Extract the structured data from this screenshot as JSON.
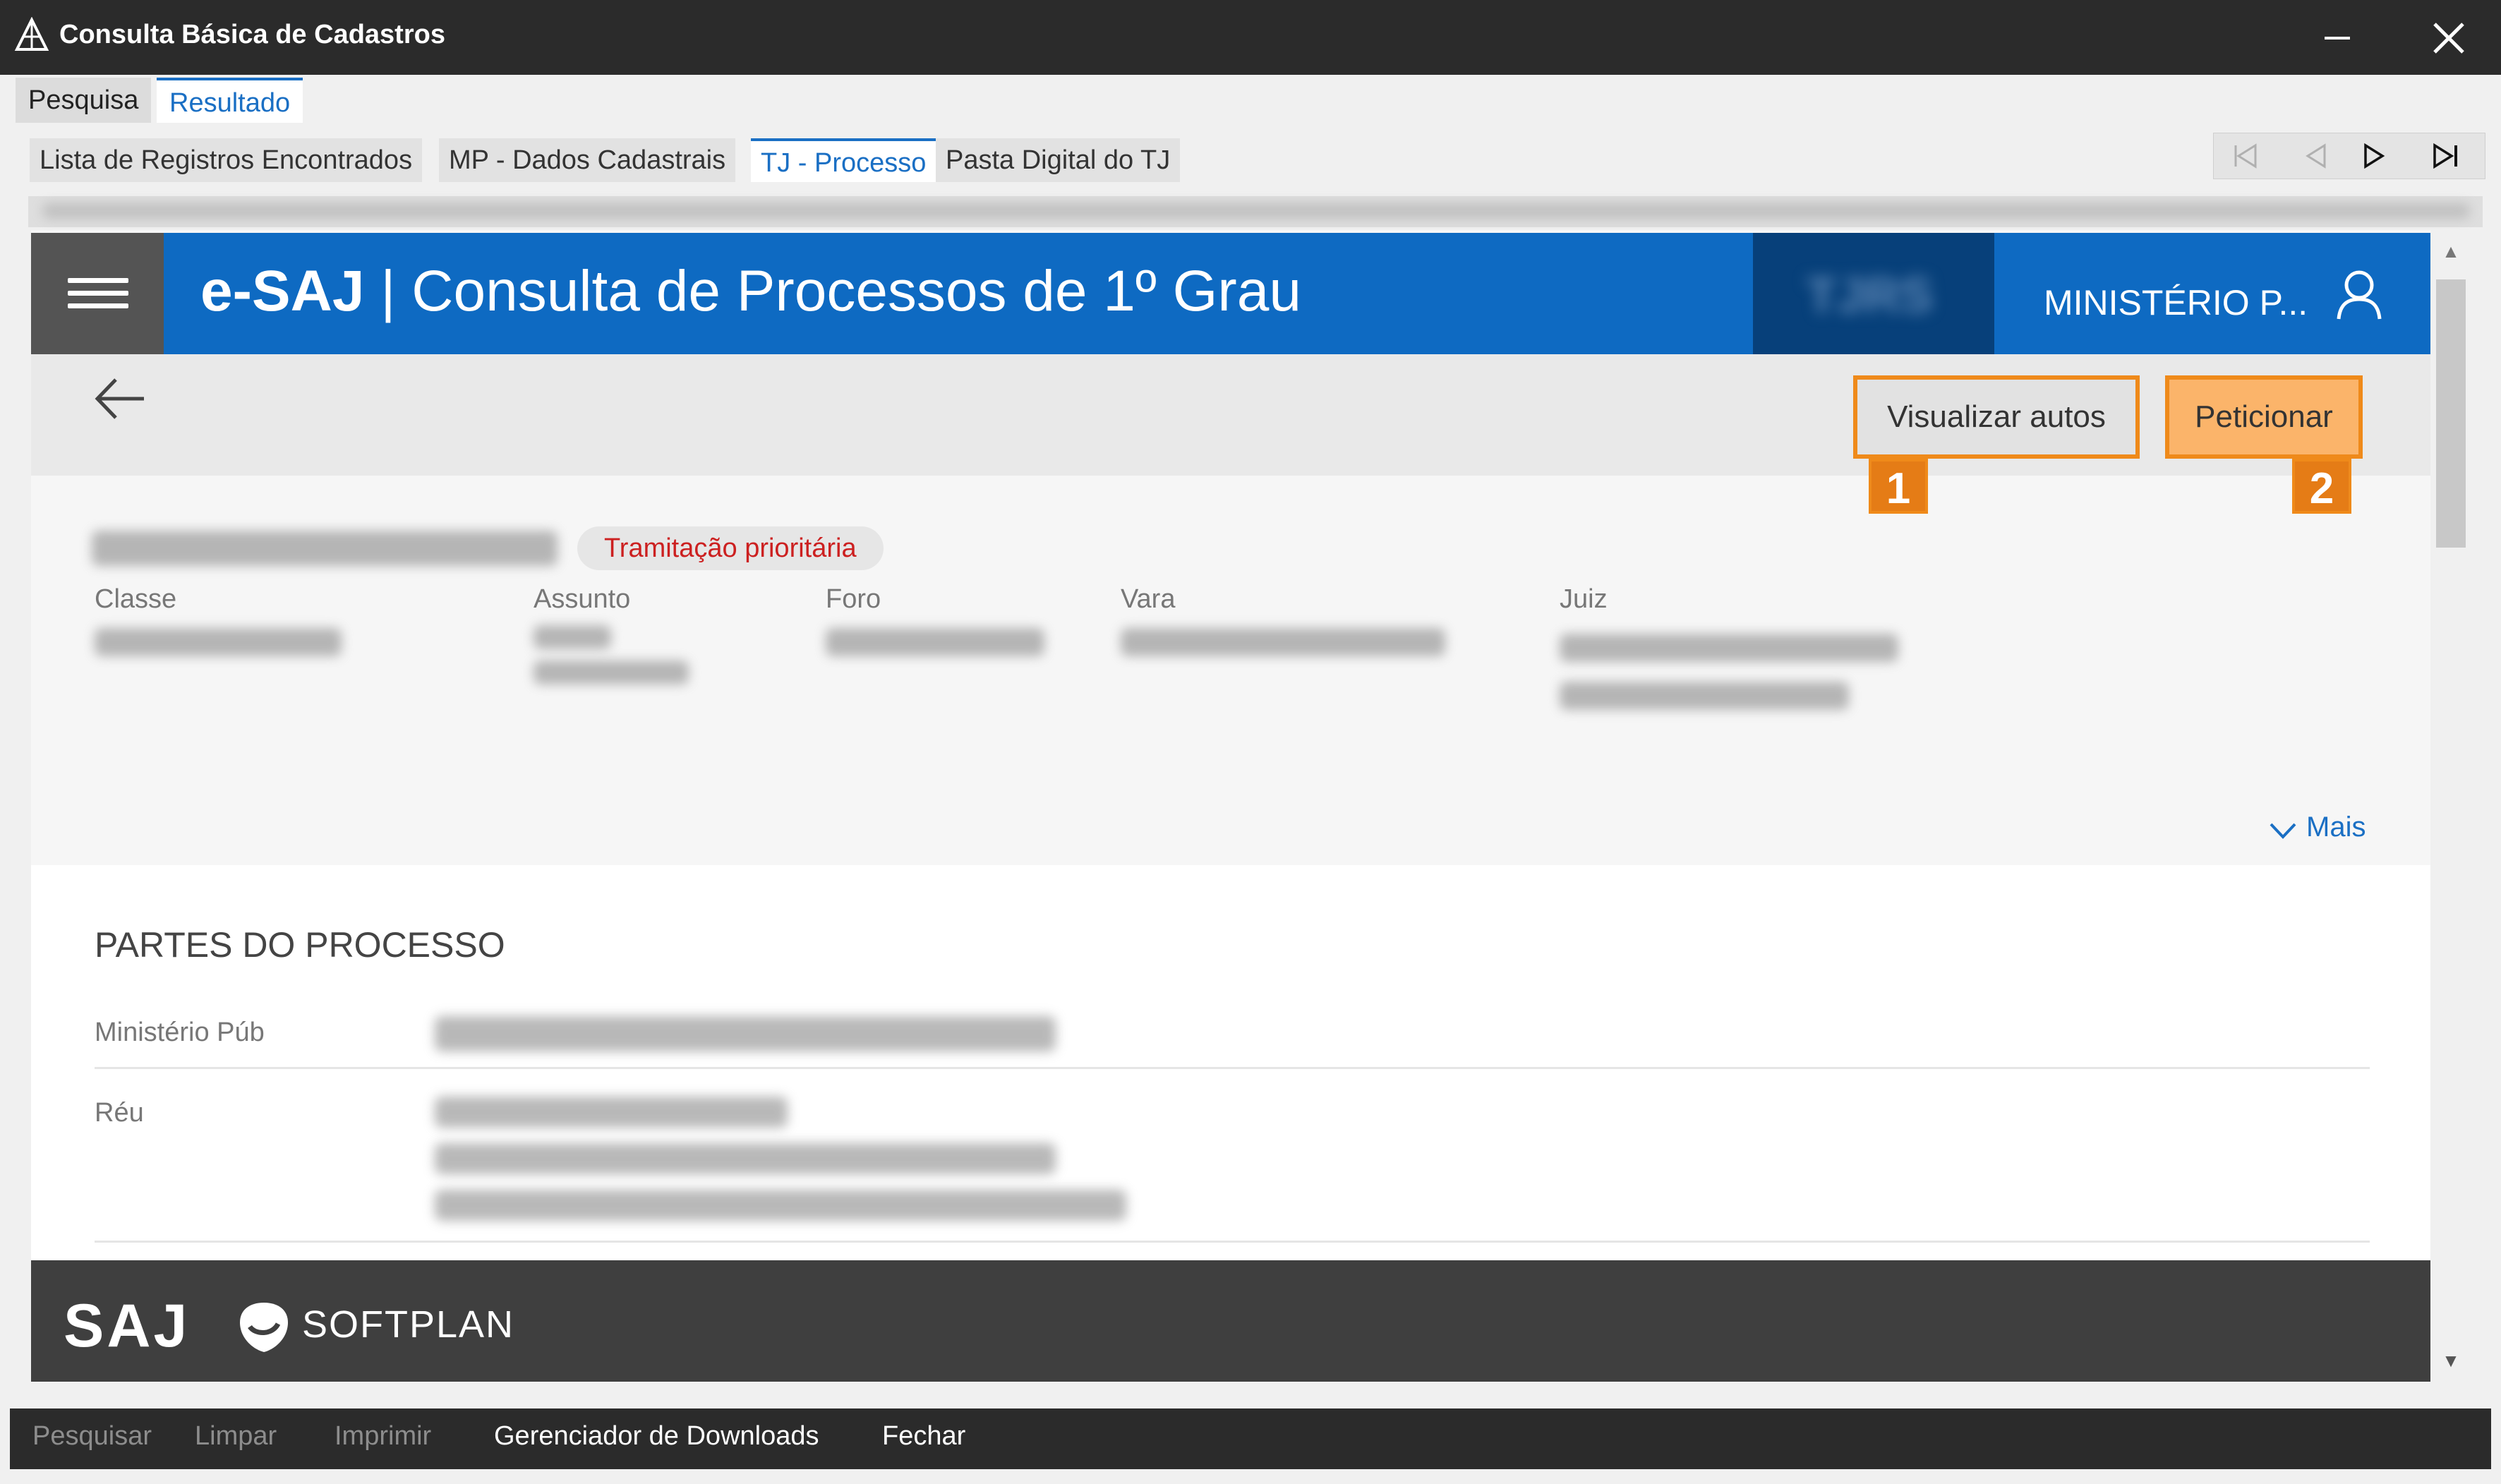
{
  "window": {
    "title": "Consulta Básica de Cadastros",
    "minimize_icon": "minimize-icon",
    "close_icon": "close-icon"
  },
  "top_tabs": [
    {
      "label": "Pesquisa",
      "active": false
    },
    {
      "label": "Resultado",
      "active": true
    }
  ],
  "sub_tabs": [
    {
      "label": "Lista de Registros Encontrados",
      "active": false
    },
    {
      "label": "MP - Dados Cadastrais",
      "active": false
    },
    {
      "label": "TJ - Processo",
      "active": true
    },
    {
      "label": "Pasta Digital do TJ",
      "active": false
    }
  ],
  "navigation": {
    "icons": [
      "first-record-icon",
      "previous-record-icon",
      "next-record-icon",
      "last-record-icon"
    ]
  },
  "esaj": {
    "brand_bold": "e-SAJ",
    "brand_rest": " | Consulta de Processos de 1º Grau",
    "court_logo_text": "TJRS",
    "user_name": "MINISTÉRIO P...",
    "colors": {
      "header_blue": "#0e6ac2",
      "court_block": "#07407a",
      "highlight_orange": "#ef8a1a",
      "badge_red": "#cc2020",
      "link_blue": "#1a6fc4"
    }
  },
  "toolbar": {
    "visualizar_label": "Visualizar autos",
    "peticionar_label": "Peticionar",
    "callout_1": "1",
    "callout_2": "2"
  },
  "processo": {
    "badge": "Tramitação prioritária",
    "labels": {
      "classe": "Classe",
      "assunto": "Assunto",
      "foro": "Foro",
      "vara": "Vara",
      "juiz": "Juiz"
    },
    "mais_label": "Mais"
  },
  "partes": {
    "title": "PARTES DO PROCESSO",
    "rows": [
      {
        "role": "Ministério Púb"
      },
      {
        "role": "Réu"
      }
    ]
  },
  "footer": {
    "saj_logo": "SAJ",
    "softplan_logo": "SOFTPLAN"
  },
  "actions": [
    {
      "label": "Pesquisar",
      "enabled": false
    },
    {
      "label": "Limpar",
      "enabled": false
    },
    {
      "label": "Imprimir",
      "enabled": false
    },
    {
      "label": "Gerenciador de Downloads",
      "enabled": true
    },
    {
      "label": "Fechar",
      "enabled": true
    }
  ]
}
